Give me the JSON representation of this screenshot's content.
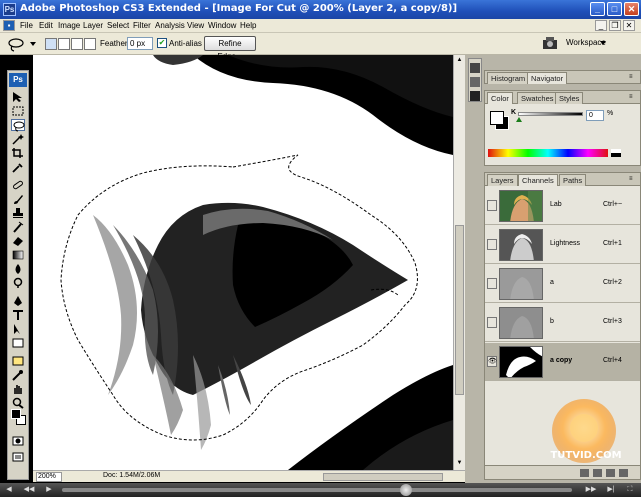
{
  "window": {
    "title": "Adobe Photoshop CS3 Extended - [Image For Cut @ 200% (Layer 2, a copy/8)]",
    "app_icon": "Ps",
    "min": "_",
    "max": "□",
    "close": "✕"
  },
  "menu": [
    "File",
    "Edit",
    "Image",
    "Layer",
    "Select",
    "Filter",
    "Analysis",
    "View",
    "Window",
    "Help"
  ],
  "options": {
    "feather_label": "Feather:",
    "feather_value": "0 px",
    "antialias_label": "Anti-alias",
    "refine_label": "Refine Edge...",
    "workspace_label": "Workspace"
  },
  "tools": {
    "logo": "Ps"
  },
  "panels": {
    "top_tabs": [
      "Histogram",
      "Navigator"
    ],
    "color_tabs": [
      "Color",
      "Swatches",
      "Styles"
    ],
    "color": {
      "channel_label": "K",
      "value": "0",
      "unit": "%"
    },
    "channel_tabs": [
      "Layers",
      "Channels",
      "Paths"
    ],
    "channels": [
      {
        "name": "Lab",
        "shortcut": "Ctrl+~",
        "visible": false,
        "selected": false
      },
      {
        "name": "Lightness",
        "shortcut": "Ctrl+1",
        "visible": false,
        "selected": false
      },
      {
        "name": "a",
        "shortcut": "Ctrl+2",
        "visible": false,
        "selected": false
      },
      {
        "name": "b",
        "shortcut": "Ctrl+3",
        "visible": false,
        "selected": false
      },
      {
        "name": "a copy",
        "shortcut": "Ctrl+4",
        "visible": true,
        "selected": true
      }
    ]
  },
  "status": {
    "zoom": "200%",
    "doc": "Doc: 1.54M/2.06M"
  },
  "watermark": {
    "text": "TUTVID.COM"
  },
  "colors": {
    "titlebar": "#1f4fb8",
    "chrome": "#ece9d8",
    "panel": "#e7e5dc",
    "selected_row": "#b5b2a4"
  }
}
